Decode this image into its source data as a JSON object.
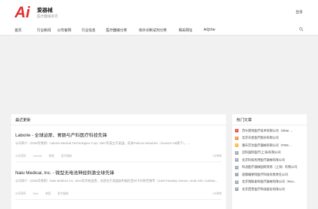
{
  "header": {
    "logo_text": "Ai",
    "title": "爱器械",
    "subtitle": "医疗器械资讯",
    "login": "登录"
  },
  "colors": {
    "logo": "#e22d2d",
    "rank_top": [
      "#e2534b",
      "#f1914f",
      "#f6b93c"
    ],
    "rank_default": "#9ea7b4"
  },
  "nav": {
    "items": [
      "首页",
      "行业新闻",
      "公司官网",
      "行业信息",
      "医疗器械分类",
      "体外诊断试剂分类",
      "相关网址",
      "AiQiXie"
    ],
    "search_icon": "search-icon"
  },
  "main": {
    "heading": "最近更新",
    "articles": [
      {
        "title": "Laborie - 全球泌尿、胃肠与产科医疗科技先锋",
        "excerpt": "公司简介（2026年更新）Laborie Medical Technologies Corp. 1967年成立于美国，前身Patricia Industries（Investor AB旗下）。...",
        "meta": [
          "公司官网",
          "Laborie",
          "美国",
          "医疗器械"
        ],
        "stats": "1分钟前"
      },
      {
        "title": "Nalu Medical, Inc. - 微型无电池神经刺激全球先锋",
        "excerpt": "公司简介（2026年更新）Nalu Medical, Inc. 2014年开始运营，总部位于美国加利福尼亚州卡尔斯巴德市（2320 Faraday Avenue, Suite 100, Carlsba...",
        "meta": [
          "公司官网",
          "Nalu",
          "美国",
          "医疗器械"
        ],
        "stats": "1分钟前"
      }
    ]
  },
  "side": {
    "heading": "热门文章",
    "items": [
      "苏州谱地医疗技术有限公司（Shan ...",
      "北京天星医疗股份有限公司",
      "重庆京沈医疗器械有限公司（FWS ...",
      "迈科国际医疗(上海)有限公司",
      "北京科技民用医疗器械有限公司",
      "科迪医疗器械国际贸易（上海）有限公司",
      "成都雅德铭医疗科技有限责任公司",
      "北京瑞联泰科医疗器械有限公司（Run...",
      "北京西普医疗科技股份有限公司"
    ]
  }
}
